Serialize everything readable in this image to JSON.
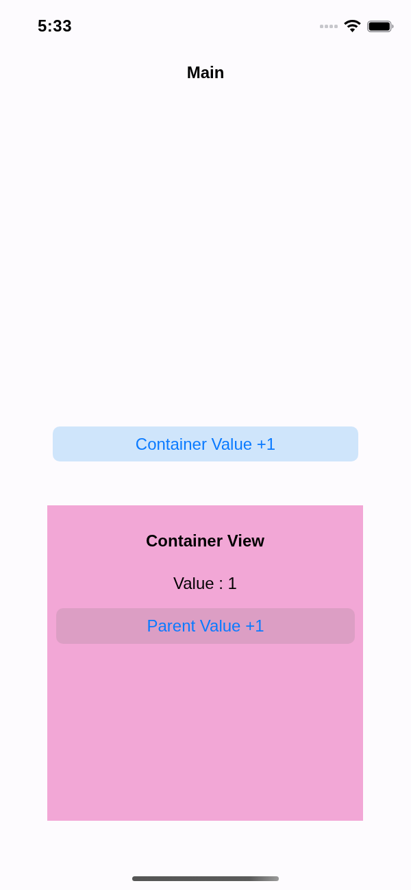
{
  "status_bar": {
    "time": "5:33"
  },
  "navigation_bar": {
    "title": "Main"
  },
  "container_button": {
    "label": "Container Value +1"
  },
  "container_view": {
    "title": "Container View",
    "value_label": "Value : 1",
    "parent_button": {
      "label": "Parent Value +1"
    }
  }
}
